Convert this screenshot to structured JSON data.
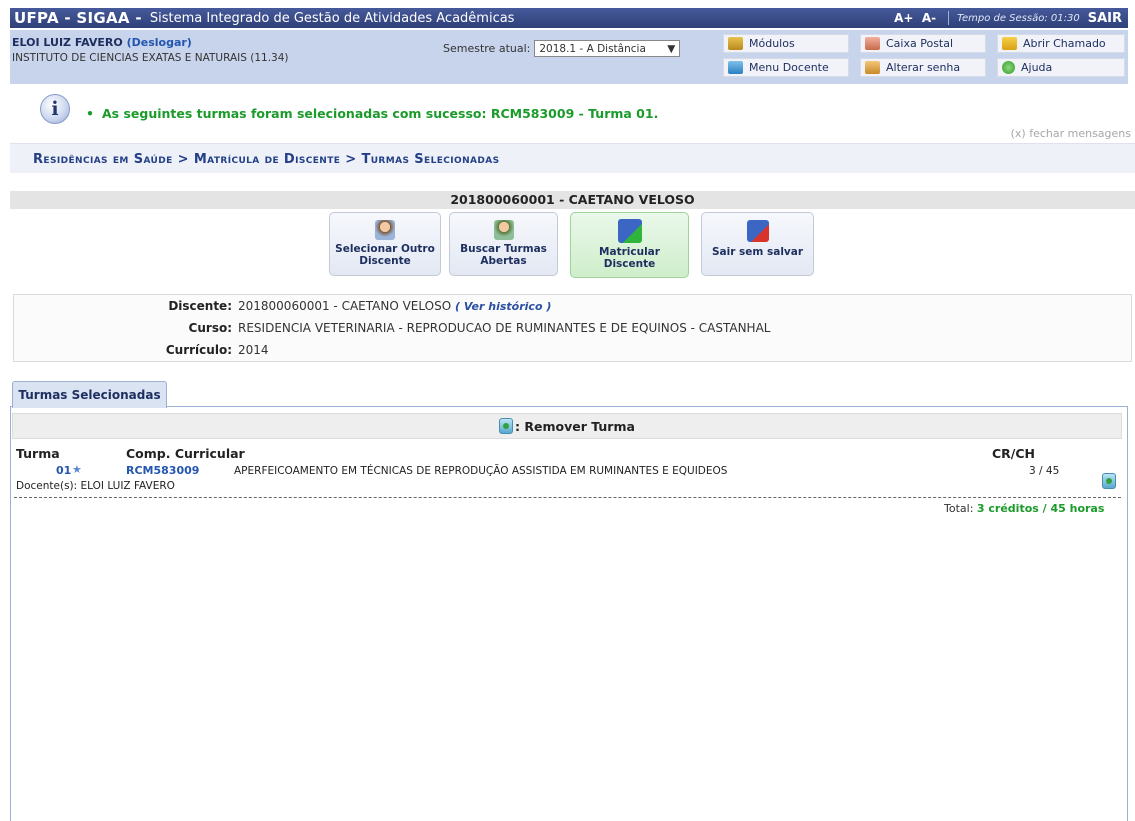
{
  "topbar": {
    "brand": "UFPA - SIGAA -",
    "system_name": "Sistema Integrado de Gestão de Atividades Acadêmicas",
    "font_increase": "A+",
    "font_decrease": "A-",
    "session_label": "Tempo de Sessão: 01:30",
    "logout": "SAIR"
  },
  "user": {
    "name": "ELOI LUIZ FAVERO",
    "logout_link": "(Deslogar)",
    "unit": "INSTITUTO DE CIENCIAS EXATAS E NATURAIS (11.34)"
  },
  "semester": {
    "label": "Semestre atual:",
    "selected": "2018.1 - A Distância",
    "arrow": "▼"
  },
  "menu": {
    "modulos": "Módulos",
    "caixa_postal": "Caixa Postal",
    "abrir_chamado": "Abrir Chamado",
    "menu_docente": "Menu Docente",
    "alterar_senha": "Alterar senha",
    "ajuda": "Ajuda"
  },
  "message": {
    "icon_letter": "i",
    "bullet": "•",
    "text": "As seguintes turmas foram selecionadas com sucesso: RCM583009 - Turma 01.",
    "close": "(x) fechar mensagens"
  },
  "breadcrumb": "Residências em Saúde > Matrícula de Discente > Turmas Selecionadas",
  "student_title": "201800060001 - CAETANO VELOSO",
  "actions": {
    "select_other_1": "Selecionar Outro",
    "select_other_2": "Discente",
    "search_1": "Buscar Turmas",
    "search_2": "Abertas",
    "enroll_1": "Matricular",
    "enroll_2": "Discente",
    "exit": "Sair sem salvar"
  },
  "student": {
    "discente_label": "Discente:",
    "discente_value": "201800060001 - CAETANO VELOSO",
    "historico_link": "( Ver histórico )",
    "curso_label": "Curso:",
    "curso_value": "RESIDENCIA VETERINARIA - REPRODUCAO DE RUMINANTES E DE EQUINOS - CASTANHAL",
    "curriculo_label": "Currículo:",
    "curriculo_value": "2014"
  },
  "tab": {
    "label": "Turmas Selecionadas"
  },
  "legend": {
    "remove": ": Remover Turma"
  },
  "table": {
    "headers": {
      "turma": "Turma",
      "comp": "Comp. Curricular",
      "crch": "CR/CH"
    },
    "row": {
      "turma": "01",
      "star": "★",
      "code": "RCM583009",
      "name": "APERFEICOAMENTO EM TÉCNICAS DE REPRODUÇÃO ASSISTIDA EM RUMINANTES E EQUIDEOS",
      "crch": "3 / 45",
      "docente": "Docente(s): ELOI LUIZ FAVERO"
    },
    "total_label": "Total:",
    "total_value": "3 créditos / 45 horas"
  }
}
